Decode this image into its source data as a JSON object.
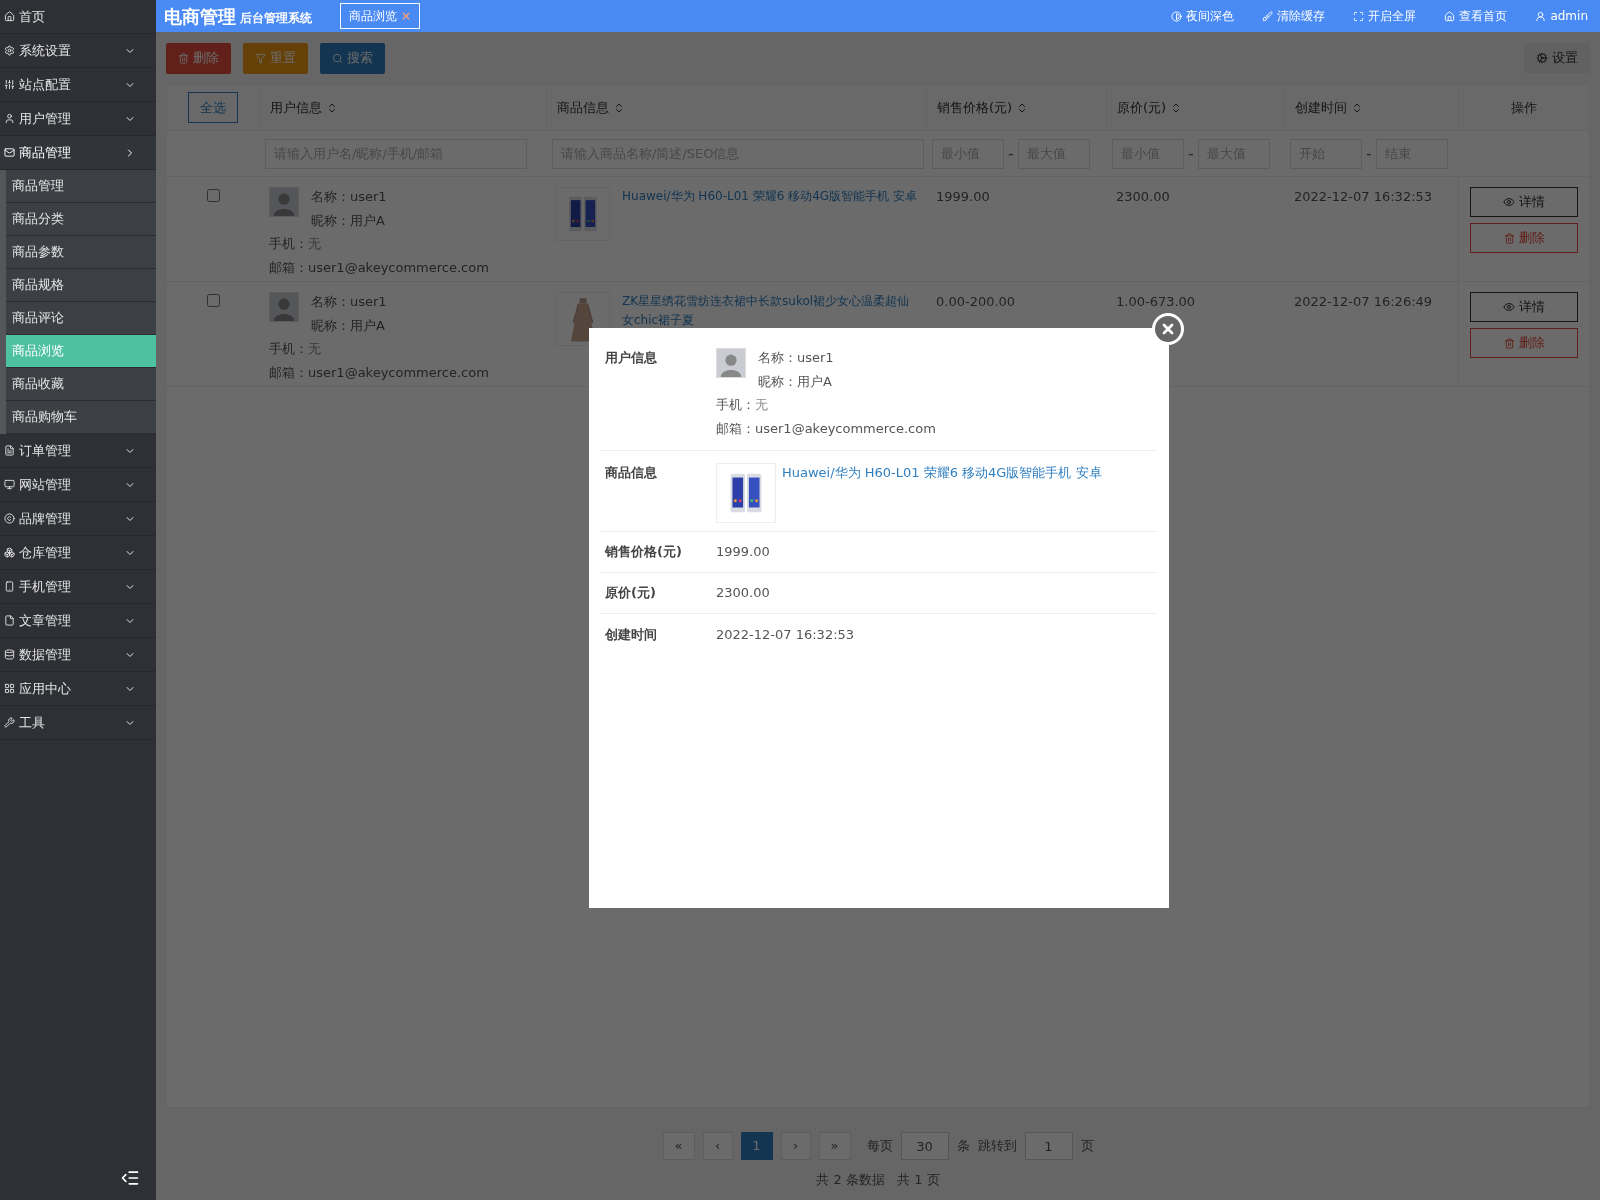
{
  "sidebar": {
    "items": [
      {
        "label": "首页",
        "expandable": false
      },
      {
        "label": "系统设置",
        "expandable": true,
        "expanded": false
      },
      {
        "label": "站点配置",
        "expandable": true,
        "expanded": false
      },
      {
        "label": "用户管理",
        "expandable": true,
        "expanded": false
      },
      {
        "label": "商品管理",
        "expandable": true,
        "expanded": true,
        "children": [
          {
            "label": "商品管理",
            "selected": false
          },
          {
            "label": "商品分类",
            "selected": false
          },
          {
            "label": "商品参数",
            "selected": false
          },
          {
            "label": "商品规格",
            "selected": false
          },
          {
            "label": "商品评论",
            "selected": false
          },
          {
            "label": "商品浏览",
            "selected": true
          },
          {
            "label": "商品收藏",
            "selected": false
          },
          {
            "label": "商品购物车",
            "selected": false
          }
        ]
      },
      {
        "label": "订单管理",
        "expandable": true,
        "expanded": false
      },
      {
        "label": "网站管理",
        "expandable": true,
        "expanded": false
      },
      {
        "label": "品牌管理",
        "expandable": true,
        "expanded": false
      },
      {
        "label": "仓库管理",
        "expandable": true,
        "expanded": false
      },
      {
        "label": "手机管理",
        "expandable": true,
        "expanded": false
      },
      {
        "label": "文章管理",
        "expandable": true,
        "expanded": false
      },
      {
        "label": "数据管理",
        "expandable": true,
        "expanded": false
      },
      {
        "label": "应用中心",
        "expandable": true,
        "expanded": false
      },
      {
        "label": "工具",
        "expandable": true,
        "expanded": false
      }
    ]
  },
  "header": {
    "title": "电商管理",
    "subtitle": "后台管理系统",
    "tab": {
      "label": "商品浏览",
      "close": "×"
    },
    "actions": [
      "夜间深色",
      "清除缓存",
      "开启全屏",
      "查看首页",
      "admin"
    ]
  },
  "toolbar": {
    "buttons": [
      "删除",
      "重置",
      "搜索"
    ],
    "settings": "设置"
  },
  "table": {
    "select_all": "全选",
    "columns": [
      "用户信息",
      "商品信息",
      "销售价格(元)",
      "原价(元)",
      "创建时间",
      "操作"
    ],
    "filters": {
      "user": {
        "placeholder": "请输入用户名/昵称/手机/邮箱"
      },
      "product": {
        "placeholder": "请输入商品名称/简述/SEO信息"
      },
      "price": [
        {
          "placeholder": "最小值"
        },
        {
          "placeholder": "最大值"
        }
      ],
      "original": [
        {
          "placeholder": "最小值"
        },
        {
          "placeholder": "最大值"
        }
      ],
      "time": [
        {
          "placeholder": "开始"
        },
        {
          "placeholder": "结束"
        }
      ],
      "separator": "-"
    },
    "rows": [
      {
        "checked": false,
        "name": "名称：user1",
        "nickname": "昵称：用户A",
        "phone_label": "手机：",
        "phone": "无",
        "email": "邮箱：user1@akeycommerce.com",
        "product": "Huawei/华为 H60-L01 荣耀6 移动4G版智能手机 安卓",
        "price": "1999.00",
        "original": "2300.00",
        "time": "2022-12-07 16:32:53",
        "actions": [
          "详情",
          "删除"
        ]
      },
      {
        "checked": false,
        "name": "名称：user1",
        "nickname": "昵称：用户A",
        "phone_label": "手机：",
        "phone": "无",
        "email": "邮箱：user1@akeycommerce.com",
        "product": "ZK星星绣花雪纺连衣裙中长款sukol裙少女心温柔超仙女chic裙子夏",
        "price": "0.00-200.00",
        "original": "1.00-673.00",
        "time": "2022-12-07 16:26:49",
        "actions": [
          "详情",
          "删除"
        ]
      }
    ]
  },
  "pagination": {
    "first": "«",
    "prev": "‹",
    "pages": [
      {
        "label": "1",
        "selected": true
      }
    ],
    "next": "›",
    "last": "»",
    "per_page_label": "每页",
    "per_page": "30",
    "unit": "条",
    "jump_label": "跳转到",
    "jump": "1",
    "page_unit": "页",
    "summary": "共 2 条数据   共 1 页"
  },
  "modal": {
    "user_label": "用户信息",
    "name": "名称：user1",
    "nickname": "昵称：用户A",
    "phone_label": "手机：",
    "phone": "无",
    "email": "邮箱：user1@akeycommerce.com",
    "product_label": "商品信息",
    "product": "Huawei/华为 H60-L01 荣耀6 移动4G版智能手机 安卓",
    "fields": [
      {
        "label": "销售价格(元)",
        "value": "1999.00"
      },
      {
        "label": "原价(元)",
        "value": "2300.00"
      },
      {
        "label": "创建时间",
        "value": "2022-12-07 16:32:53"
      }
    ]
  }
}
